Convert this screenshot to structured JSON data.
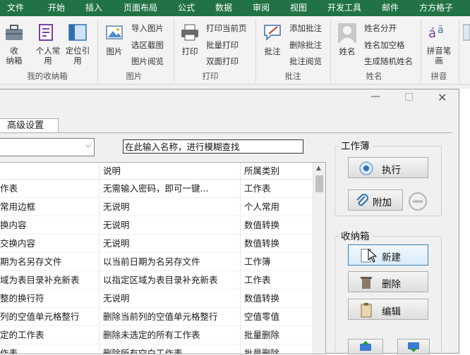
{
  "ribbon_tabs": [
    "文件",
    "开始",
    "插入",
    "页面布局",
    "公式",
    "数据",
    "审阅",
    "视图",
    "开发工具",
    "邮件",
    "方方格子"
  ],
  "ribbon": {
    "groups": {
      "storage": {
        "label": "我的收纳箱",
        "btn1": "收\n纳箱",
        "btn2": "个人常\n用",
        "btn3": "定位引\n用"
      },
      "picture": {
        "label": "图片",
        "btn": "图片",
        "items": [
          "导入图片",
          "选区截图",
          "图片阅览"
        ]
      },
      "print": {
        "label": "打印",
        "btn": "打印",
        "items": [
          "打印当前页",
          "批量打印",
          "双面打印"
        ]
      },
      "comment": {
        "label": "批注",
        "btn": "批注",
        "items": [
          "添加批注",
          "删除批注",
          "批注阅览"
        ]
      },
      "name": {
        "label": "姓名",
        "btn": "姓名",
        "items": [
          "姓名分开",
          "姓名加空格",
          "生成随机姓名"
        ]
      },
      "pinyin": {
        "label": "拼音",
        "btn": "拼音笔\n画"
      }
    }
  },
  "dialog": {
    "tab_label": "高级设置",
    "search_placeholder": "在此输入名称，进行模糊查找",
    "columns": {
      "desc": "说明",
      "category": "所属类别"
    },
    "rows": [
      {
        "name": "作表",
        "desc": "无需输入密码，即可一键...",
        "cat": "工作表"
      },
      {
        "name": "常用边框",
        "desc": "无说明",
        "cat": "个人常用"
      },
      {
        "name": "换内容",
        "desc": "无说明",
        "cat": "数值转换"
      },
      {
        "name": "交换内容",
        "desc": "无说明",
        "cat": "数值转换"
      },
      {
        "name": "期为名另存文件",
        "desc": "以当前日期为名另存文件",
        "cat": "工作簿"
      },
      {
        "name": "域为表目录补充新表",
        "desc": "以指定区域为表目录补充新表",
        "cat": "工作表"
      },
      {
        "name": "整的换行符",
        "desc": "无说明",
        "cat": "数值转换"
      },
      {
        "name": "列的空值单元格整行",
        "desc": "删除当前列的空值单元格整行",
        "cat": "空值零值"
      },
      {
        "name": "定的工作表",
        "desc": "删除未选定的所有工作表",
        "cat": "批量删除"
      },
      {
        "name": "作表",
        "desc": "删除所有空白工作表",
        "cat": "批量删除"
      }
    ],
    "workbook_group": {
      "title": "工作薄",
      "execute": "执行",
      "attach": "附加"
    },
    "storage_group": {
      "title": "收纳箱",
      "new": "新建",
      "delete": "删除",
      "edit": "编辑"
    }
  }
}
